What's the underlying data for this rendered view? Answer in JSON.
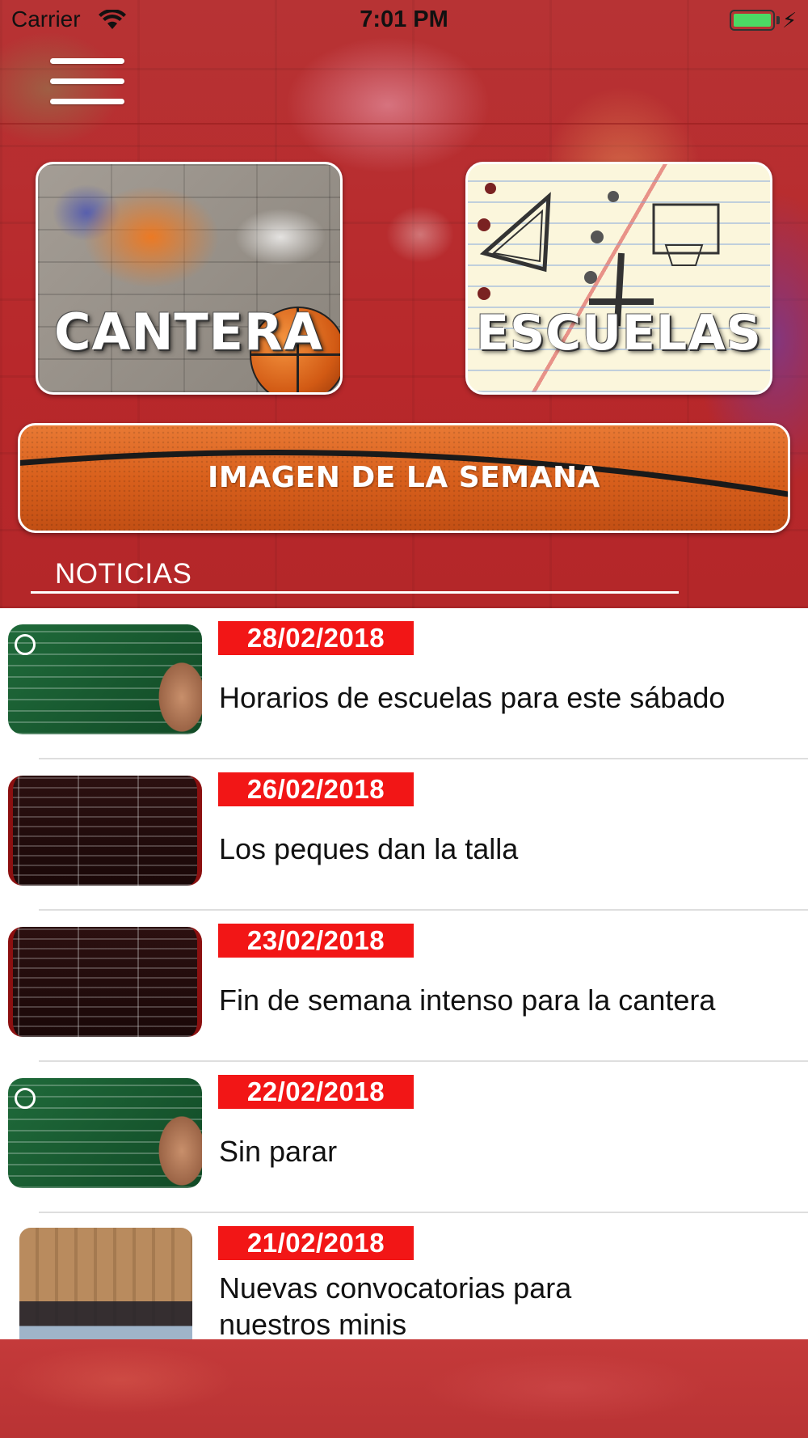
{
  "status_bar": {
    "carrier": "Carrier",
    "time": "7:01 PM",
    "battery_color": "#4cd964"
  },
  "tiles": {
    "cantera": "CANTERA",
    "escuelas": "ESCUELAS"
  },
  "week_banner": {
    "label": "IMAGEN DE LA SEMANA"
  },
  "news": {
    "heading": "NOTICIAS",
    "items": [
      {
        "date": "28/02/2018",
        "title": "Horarios de escuelas para este sábado",
        "thumb": "chalkboard-schedule"
      },
      {
        "date": "26/02/2018",
        "title": "Los peques dan la talla",
        "thumb": "results-table"
      },
      {
        "date": "23/02/2018",
        "title": "Fin de semana intenso para la cantera",
        "thumb": "results-table"
      },
      {
        "date": "22/02/2018",
        "title": "Sin parar",
        "thumb": "chalkboard-schedule"
      },
      {
        "date": "21/02/2018",
        "title": "Nuevas convocatorias para nuestros minis",
        "thumb": "team-photo"
      }
    ]
  },
  "colors": {
    "background_red": "#b8262a",
    "date_badge": "#f21616",
    "banner_orange": "#d9601c"
  }
}
